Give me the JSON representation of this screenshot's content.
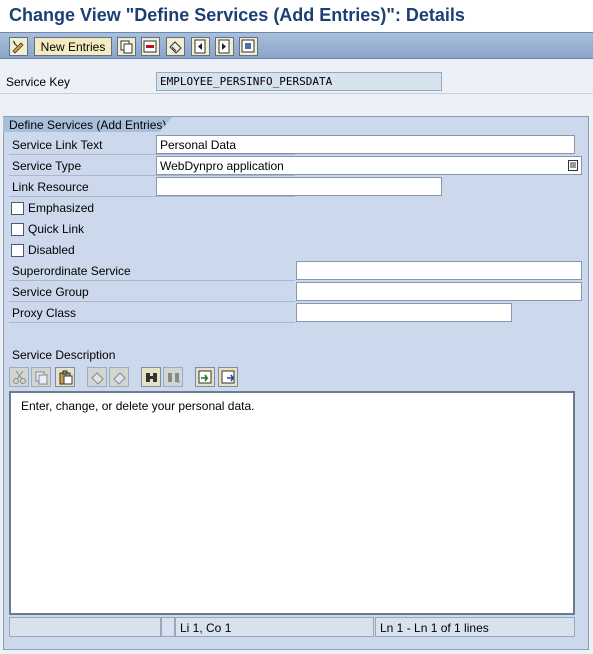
{
  "title": "Change View \"Define Services (Add Entries)\": Details",
  "toolbar": {
    "new_entries_label": "New Entries",
    "icons": [
      "change-display-icon",
      "copy-icon",
      "delete-icon",
      "undo-icon",
      "previous-entry-icon",
      "next-entry-icon",
      "select-all-icon"
    ]
  },
  "service_key": {
    "label": "Service Key",
    "value": "EMPLOYEE_PERSINFO_PERSDATA"
  },
  "group": {
    "title": "Define Services (Add Entries)",
    "service_link_text": {
      "label": "Service Link Text",
      "value": "Personal Data"
    },
    "service_type": {
      "label": "Service Type",
      "value": "WebDynpro application"
    },
    "link_resource": {
      "label": "Link Resource",
      "value": ""
    },
    "emphasized": {
      "label": "Emphasized",
      "checked": false
    },
    "quick_link": {
      "label": "Quick Link",
      "checked": false
    },
    "disabled": {
      "label": "Disabled",
      "checked": false
    },
    "superordinate_service": {
      "label": "Superordinate Service",
      "value": ""
    },
    "service_group": {
      "label": "Service Group",
      "value": ""
    },
    "proxy_class": {
      "label": "Proxy Class",
      "value": ""
    },
    "service_description": {
      "label": "Service Description"
    }
  },
  "editor": {
    "text": "Enter, change, or delete your personal data.",
    "toolbar_icons": [
      "cut-icon",
      "copy-icon",
      "paste-icon",
      "undo-icon",
      "redo-icon",
      "find-icon",
      "find-next-icon",
      "import-icon",
      "export-icon"
    ]
  },
  "status_bar": {
    "cell1": "",
    "cell2": "",
    "position": "Li 1, Co 1",
    "lines": "Ln 1 - Ln 1 of 1 lines"
  },
  "colors": {
    "title": "#1d3f73",
    "toolbar": "#9bb3d3",
    "group_bg": "#ccd9ec",
    "button_bg": "#f4ecc0"
  }
}
